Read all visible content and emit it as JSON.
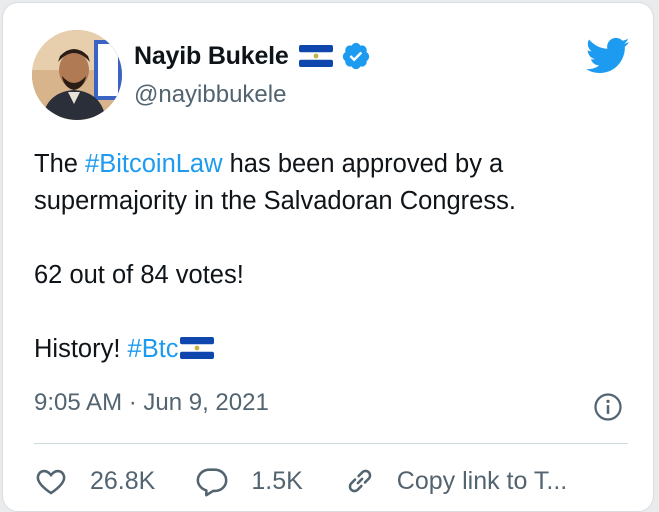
{
  "author": {
    "display_name": "Nayib Bukele",
    "handle": "@nayibbukele",
    "flag_icon": "el-salvador-flag-icon",
    "verified_icon": "verified-badge-icon",
    "verified_color": "#1d9bf0"
  },
  "tweet": {
    "line1_pre": "The ",
    "line1_hashtag": "#BitcoinLaw",
    "line1_post": " has been approved by a",
    "line2": "supermajority in the Salvadoran Congress.",
    "line3": "62 out of 84 votes!",
    "line4_pre": "History! ",
    "line4_hashtag": "#Btc",
    "hashtag_color": "#1d9bf0"
  },
  "meta": {
    "timestamp": "9:05 AM · Jun 9, 2021",
    "info_icon": "info-icon"
  },
  "actions": {
    "likes": "26.8K",
    "replies": "1.5K",
    "copy_link": "Copy link to T..."
  },
  "brand": {
    "logo_icon": "twitter-bird-icon",
    "color": "#1d9bf0"
  }
}
